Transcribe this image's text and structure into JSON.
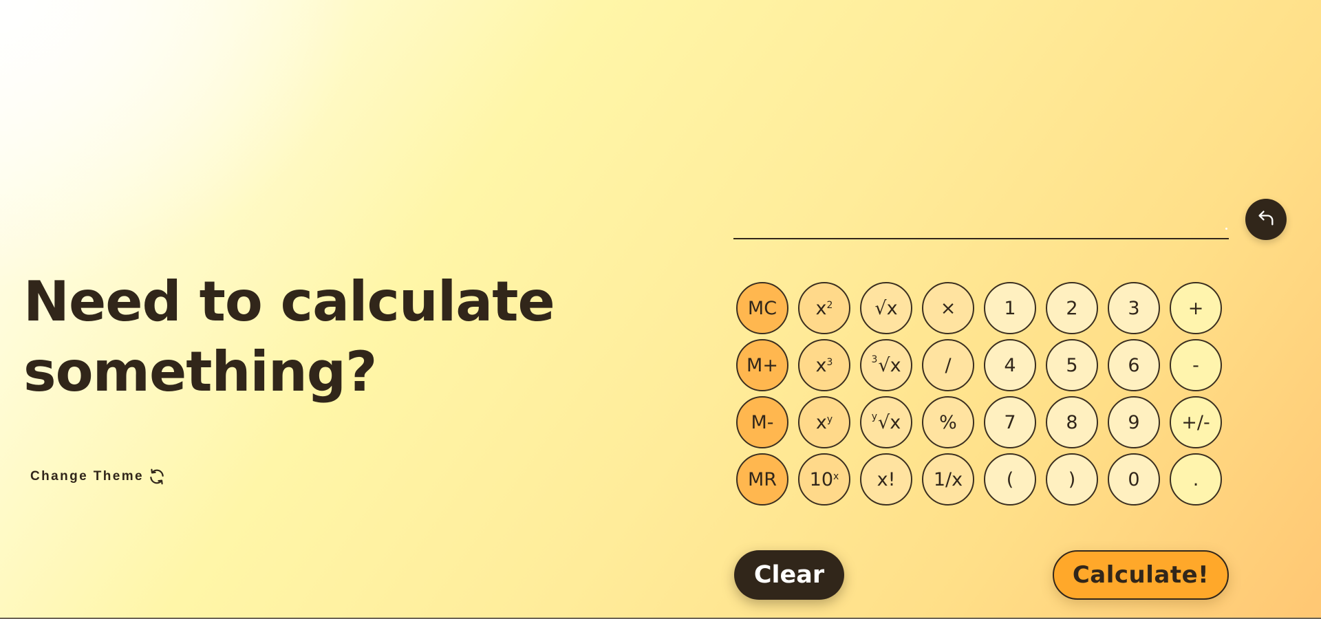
{
  "headline": {
    "line1": "Need to calculate",
    "line2": "something?"
  },
  "theme_toggle": {
    "label": "Change Theme",
    "icon": "refresh-icon"
  },
  "display": {
    "value": "",
    "placeholder": ""
  },
  "backspace": {
    "icon": "undo-arrow-icon"
  },
  "keypad": {
    "rows": [
      [
        {
          "label": "MC",
          "name": "key-memory-clear"
        },
        {
          "base": "x",
          "sup": "2",
          "name": "key-square"
        },
        {
          "label": "√x",
          "name": "key-square-root"
        },
        {
          "label": "×",
          "name": "key-multiply"
        },
        {
          "label": "1",
          "name": "key-1"
        },
        {
          "label": "2",
          "name": "key-2"
        },
        {
          "label": "3",
          "name": "key-3"
        },
        {
          "label": "+",
          "name": "key-plus"
        }
      ],
      [
        {
          "label": "M+",
          "name": "key-memory-add"
        },
        {
          "base": "x",
          "sup": "3",
          "name": "key-cube"
        },
        {
          "pre": "3",
          "label": "√x",
          "name": "key-cube-root"
        },
        {
          "label": "/",
          "name": "key-divide"
        },
        {
          "label": "4",
          "name": "key-4"
        },
        {
          "label": "5",
          "name": "key-5"
        },
        {
          "label": "6",
          "name": "key-6"
        },
        {
          "label": "-",
          "name": "key-minus"
        }
      ],
      [
        {
          "label": "M-",
          "name": "key-memory-subtract"
        },
        {
          "base": "x",
          "sup": "y",
          "name": "key-power"
        },
        {
          "pre": "y",
          "label": "√x",
          "name": "key-nth-root"
        },
        {
          "label": "%",
          "name": "key-percent"
        },
        {
          "label": "7",
          "name": "key-7"
        },
        {
          "label": "8",
          "name": "key-8"
        },
        {
          "label": "9",
          "name": "key-9"
        },
        {
          "label": "+/-",
          "name": "key-negate"
        }
      ],
      [
        {
          "label": "MR",
          "name": "key-memory-recall"
        },
        {
          "base": "10",
          "sup": "x",
          "name": "key-ten-power"
        },
        {
          "label": "x!",
          "name": "key-factorial"
        },
        {
          "label": "1/x",
          "name": "key-reciprocal"
        },
        {
          "label": "(",
          "name": "key-open-paren"
        },
        {
          "label": ")",
          "name": "key-close-paren"
        },
        {
          "label": "0",
          "name": "key-0"
        },
        {
          "label": ".",
          "name": "key-decimal"
        }
      ]
    ],
    "column_styles": [
      "mem",
      "func",
      "op",
      "op",
      "num",
      "num",
      "num",
      "edge"
    ]
  },
  "actions": {
    "clear_label": "Clear",
    "calculate_label": "Calculate!"
  },
  "colors": {
    "dark": "#31261a",
    "memory_key": "#ffb74f",
    "function_key": "#ffd98a",
    "operator_key": "#ffe3a0",
    "number_key": "#fff0c0",
    "calculate_button": "#ffa82a"
  }
}
